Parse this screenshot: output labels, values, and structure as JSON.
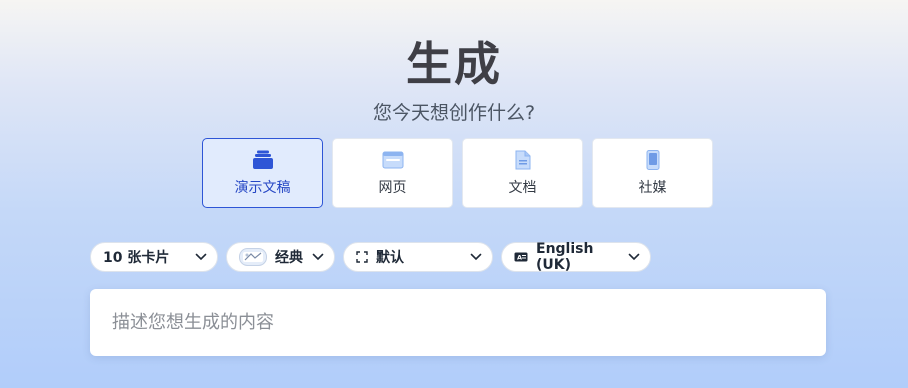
{
  "header": {
    "title": "生成",
    "subtitle": "您今天想创作什么?"
  },
  "content_types": [
    {
      "label": "演示文稿",
      "icon": "presentation-stack-icon",
      "selected": true
    },
    {
      "label": "网页",
      "icon": "webpage-icon",
      "selected": false
    },
    {
      "label": "文档",
      "icon": "document-icon",
      "selected": false
    },
    {
      "label": "社媒",
      "icon": "mobile-phone-icon",
      "selected": false
    }
  ],
  "options": {
    "card_count": "10 张卡片",
    "theme": "经典",
    "size": "默认",
    "language": "English (UK)"
  },
  "prompt": {
    "placeholder": "描述您想生成的内容",
    "value": ""
  },
  "colors": {
    "accent": "#2e55d6",
    "selected_bg": "#e1ebfd",
    "title": "#3f3f46"
  }
}
